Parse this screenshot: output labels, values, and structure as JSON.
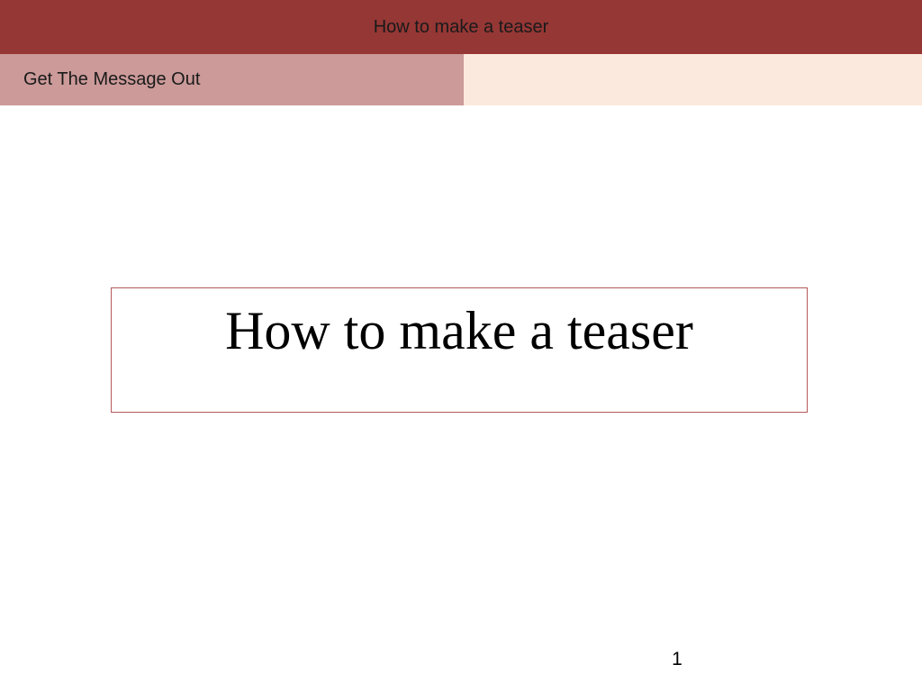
{
  "header": {
    "title": "How to make a teaser",
    "section": "Get The Message Out"
  },
  "slide": {
    "title": "How to make a teaser",
    "page_number": "1"
  },
  "colors": {
    "header_bar": "#953735",
    "section_bar": "#cb9a99",
    "section_bar_right": "#fce9dd",
    "title_border": "#b5595a"
  }
}
